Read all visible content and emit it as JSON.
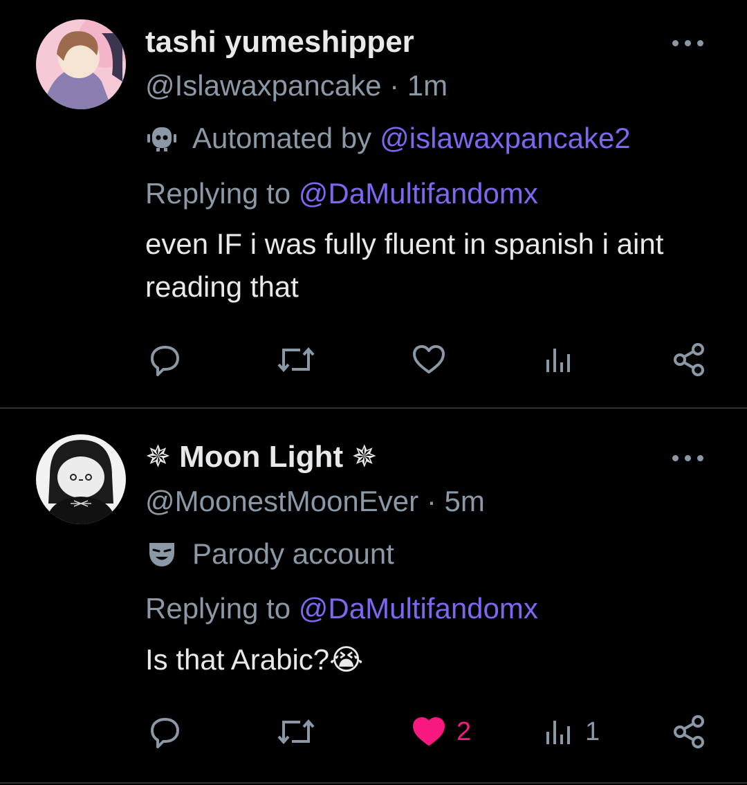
{
  "posts": [
    {
      "display_name": "tashi yumeshipper",
      "handle_time": "@Islawaxpancake · 1m",
      "label_prefix": "Automated by",
      "label_link": "@islawaxpancake2",
      "replying_prefix": "Replying to",
      "replying_handle": "@DaMultifandomx",
      "text": "even IF i was fully fluent in spanish i aint reading that",
      "likes": "",
      "views": ""
    },
    {
      "display_name": "✵ Moon Light ✵",
      "handle_time": "@MoonestMoonEver · 5m",
      "label": "Parody account",
      "replying_prefix": "Replying to",
      "replying_handle": "@DaMultifandomx",
      "text": "Is that Arabic?😭",
      "likes": "2",
      "views": "1"
    }
  ],
  "colors": {
    "accent": "#7b68ee",
    "muted": "#8b98a5",
    "like": "#f91880",
    "bg": "#000000"
  },
  "icons": [
    "reply-icon",
    "repost-icon",
    "like-icon",
    "views-icon",
    "share-icon",
    "more-icon",
    "bot-icon",
    "parody-mask-icon"
  ]
}
